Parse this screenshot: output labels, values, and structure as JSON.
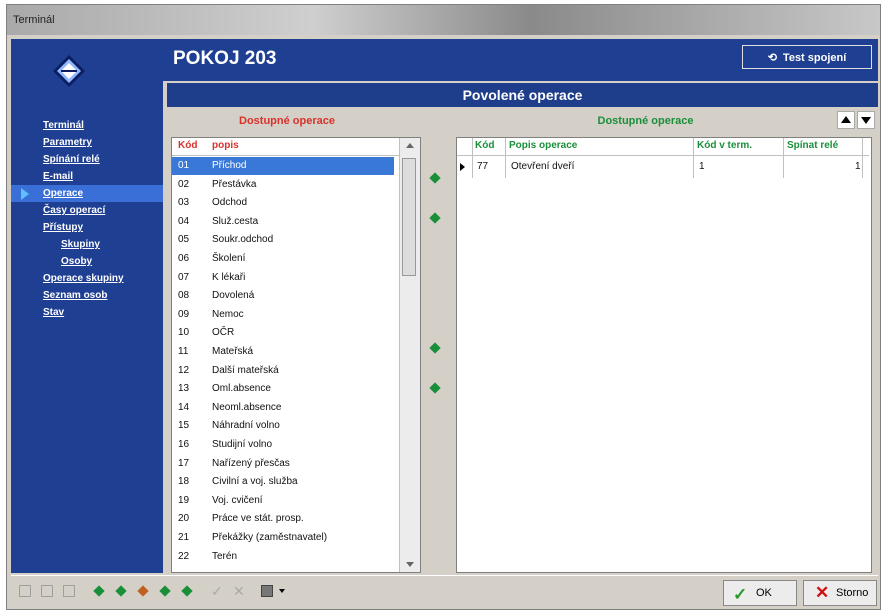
{
  "window": {
    "title": "Terminál"
  },
  "header": {
    "room": "POKOJ 203",
    "test_button": "Test spojení"
  },
  "nav": {
    "items": [
      {
        "label": "Terminál"
      },
      {
        "label": "Parametry"
      },
      {
        "label": "Spínání relé"
      },
      {
        "label": "E-mail"
      },
      {
        "label": "Operace",
        "active": true
      },
      {
        "label": "Časy operací"
      },
      {
        "label": "Přístupy"
      },
      {
        "label": "Skupiny",
        "sub": true
      },
      {
        "label": "Osoby",
        "sub": true
      },
      {
        "label": "Operace skupiny"
      },
      {
        "label": "Seznam osob"
      },
      {
        "label": "Stav"
      }
    ]
  },
  "section": {
    "title": "Povolené operace"
  },
  "left_panel": {
    "title": "Dostupné operace",
    "columns": [
      "Kód",
      "popis"
    ],
    "rows": [
      [
        "01",
        "Příchod"
      ],
      [
        "02",
        "Přestávka"
      ],
      [
        "03",
        "Odchod"
      ],
      [
        "04",
        "Služ.cesta"
      ],
      [
        "05",
        "Soukr.odchod"
      ],
      [
        "06",
        "Školení"
      ],
      [
        "07",
        "K lékaři"
      ],
      [
        "08",
        "Dovolená"
      ],
      [
        "09",
        "Nemoc"
      ],
      [
        "10",
        "OČR"
      ],
      [
        "11",
        "Mateřská"
      ],
      [
        "12",
        "Další mateřská"
      ],
      [
        "13",
        "Oml.absence"
      ],
      [
        "14",
        "Neoml.absence"
      ],
      [
        "15",
        "Náhradní volno"
      ],
      [
        "16",
        "Studijní volno"
      ],
      [
        "17",
        "Nařízený přesčas"
      ],
      [
        "18",
        "Civilní a voj. služba"
      ],
      [
        "19",
        "Voj. cvičení"
      ],
      [
        "20",
        "Práce ve stát. prosp."
      ],
      [
        "21",
        "Překážky (zaměstnavatel)"
      ],
      [
        "22",
        "Terén"
      ]
    ],
    "selected_index": 0
  },
  "right_panel": {
    "title": "Dostupné operace",
    "columns": [
      "Kód",
      "Popis operace",
      "Kód v term.",
      "Spínat relé"
    ],
    "rows": [
      [
        "77",
        "Otevření dveří",
        "1",
        "1"
      ]
    ]
  },
  "footer": {
    "ok_label": "OK",
    "cancel_label": "Storno"
  },
  "colors": {
    "panel_blue": "#1f3f93",
    "selection": "#3a78d8",
    "red": "#d8322b",
    "green": "#1a8f3a"
  }
}
